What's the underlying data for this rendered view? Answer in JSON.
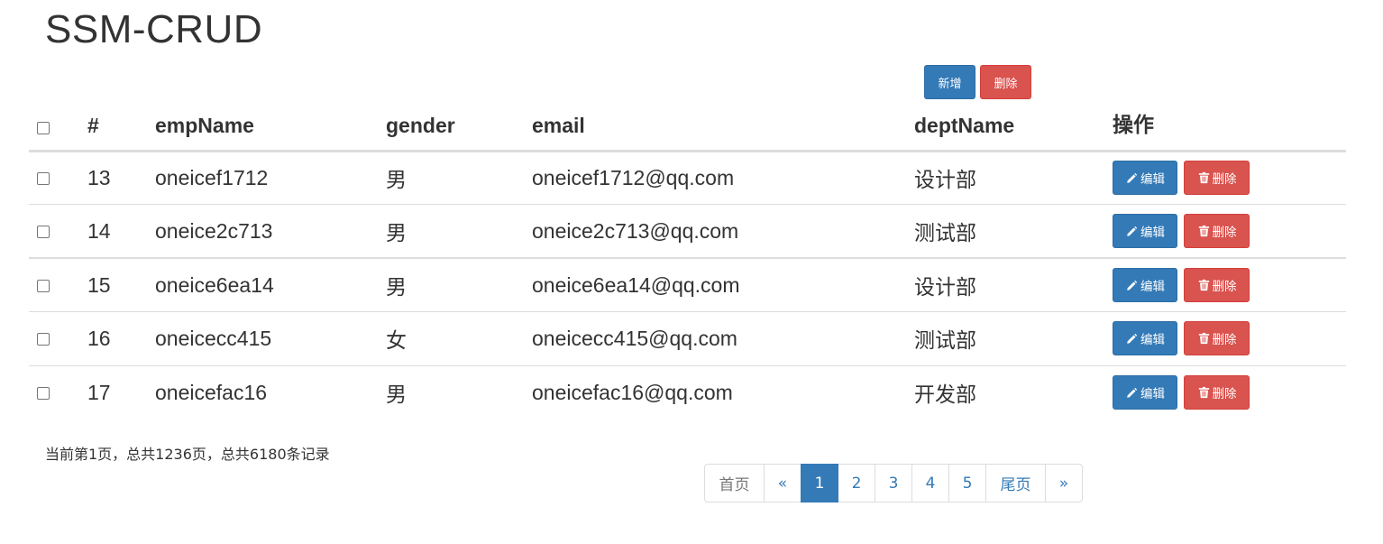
{
  "page": {
    "title": "SSM-CRUD"
  },
  "toolbar": {
    "add_label": "新增",
    "delete_label": "删除"
  },
  "table": {
    "headers": [
      "#",
      "empName",
      "gender",
      "email",
      "deptName",
      "操作"
    ],
    "rows": [
      {
        "id": "13",
        "empName": "oneicef1712",
        "gender": "男",
        "email": "oneicef1712@qq.com",
        "deptName": "设计部"
      },
      {
        "id": "14",
        "empName": "oneice2c713",
        "gender": "男",
        "email": "oneice2c713@qq.com",
        "deptName": "测试部"
      },
      {
        "id": "15",
        "empName": "oneice6ea14",
        "gender": "男",
        "email": "oneice6ea14@qq.com",
        "deptName": "设计部"
      },
      {
        "id": "16",
        "empName": "oneicecc415",
        "gender": "女",
        "email": "oneicecc415@qq.com",
        "deptName": "测试部"
      },
      {
        "id": "17",
        "empName": "oneicefac16",
        "gender": "男",
        "email": "oneicefac16@qq.com",
        "deptName": "开发部"
      }
    ],
    "row_actions": {
      "edit_label": "编辑",
      "delete_label": "删除"
    }
  },
  "icons": {
    "edit": "pencil-icon",
    "delete": "trash-icon"
  },
  "pagination": {
    "info": "当前第1页，总共1236页，总共6180条记录",
    "first": "首页",
    "prev": "«",
    "pages": [
      "1",
      "2",
      "3",
      "4",
      "5"
    ],
    "active_page": "1",
    "last": "尾页",
    "next": "»"
  },
  "colors": {
    "primary": "#337ab7",
    "danger": "#d9534f",
    "text": "#333333",
    "border": "#dddddd"
  }
}
